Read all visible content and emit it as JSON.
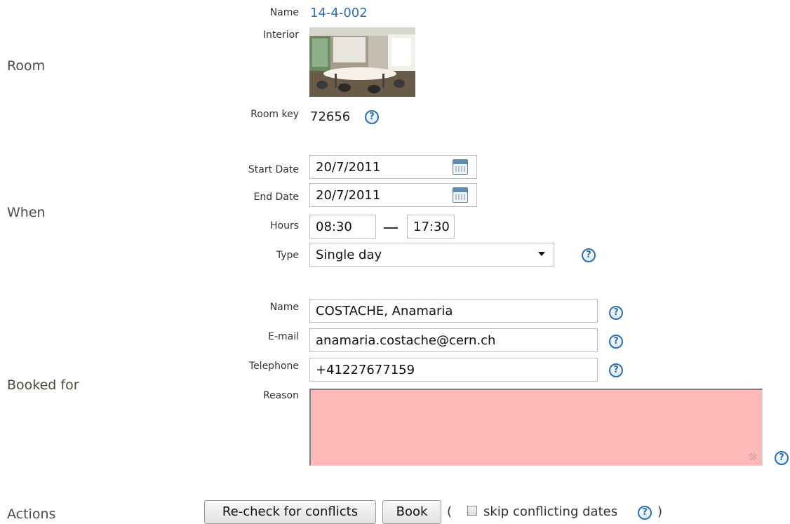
{
  "sections": {
    "room": "Room",
    "when": "When",
    "booked_for": "Booked for",
    "actions": "Actions"
  },
  "room": {
    "name_label": "Name",
    "name_value": "14-4-002",
    "interior_label": "Interior",
    "room_key_label": "Room key",
    "room_key_value": "72656"
  },
  "when": {
    "start_date_label": "Start Date",
    "start_date_value": "20/7/2011",
    "end_date_label": "End Date",
    "end_date_value": "20/7/2011",
    "hours_label": "Hours",
    "hour_start": "08:30",
    "hour_end": "17:30",
    "type_label": "Type",
    "type_value": "Single day"
  },
  "booked_for": {
    "name_label": "Name",
    "name_value": "COSTACHE, Anamaria",
    "email_label": "E-mail",
    "email_value": "anamaria.costache@cern.ch",
    "telephone_label": "Telephone",
    "telephone_value": "+41227677159",
    "reason_label": "Reason",
    "reason_value": "",
    "reason_bg": "#ffb9b9"
  },
  "actions": {
    "recheck_label": "Re-check for conflicts",
    "book_label": "Book",
    "paren_open": "(",
    "skip_label": "skip conflicting dates",
    "paren_close": ")"
  },
  "help_glyph": "?",
  "colors": {
    "link": "#2c6fb7",
    "help": "#2d6fb5",
    "section_label": "#4b4b3f"
  }
}
